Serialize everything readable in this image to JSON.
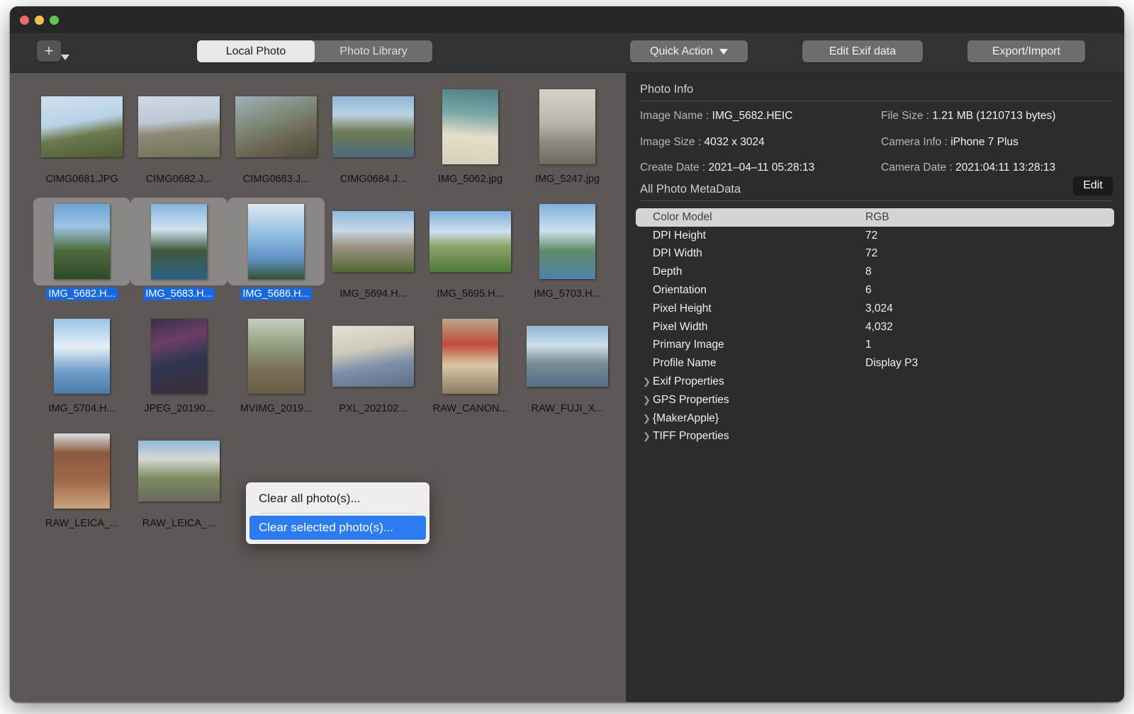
{
  "window": {
    "traffic_lights": [
      "close",
      "minimize",
      "maximize"
    ]
  },
  "toolbar": {
    "add_button": "+",
    "add_caret_icon": "caret-down-icon",
    "segments": [
      {
        "label": "Local Photo",
        "active": true
      },
      {
        "label": "Photo Library",
        "active": false
      }
    ],
    "quick_action": "Quick Action",
    "quick_action_caret": "caret-down-icon",
    "edit_exif": "Edit Exif data",
    "export_import": "Export/Import"
  },
  "grid": {
    "photos": [
      {
        "name": "CIMG0681.JPG",
        "selected": false,
        "orient": "landscape",
        "scene": "temple"
      },
      {
        "name": "CIMG0682.J...",
        "selected": false,
        "orient": "landscape",
        "scene": "pavilion"
      },
      {
        "name": "CIMG0683.J...",
        "selected": false,
        "orient": "landscape",
        "scene": "building"
      },
      {
        "name": "CIMG0684.J...",
        "selected": false,
        "orient": "landscape",
        "scene": "canal"
      },
      {
        "name": "IMG_5062.jpg",
        "selected": false,
        "orient": "portrait",
        "scene": "beach"
      },
      {
        "name": "IMG_5247.jpg",
        "selected": false,
        "orient": "portrait",
        "scene": "station"
      },
      {
        "name": "IMG_5682.H...",
        "selected": true,
        "orient": "portrait",
        "scene": "palm-sky"
      },
      {
        "name": "IMG_5683.H...",
        "selected": true,
        "orient": "portrait",
        "scene": "pool-sky"
      },
      {
        "name": "IMG_5686.H...",
        "selected": true,
        "orient": "portrait",
        "scene": "clouds"
      },
      {
        "name": "IMG_5694.H...",
        "selected": false,
        "orient": "landscape",
        "scene": "resort"
      },
      {
        "name": "IMG_5695.H...",
        "selected": false,
        "orient": "landscape",
        "scene": "lawn"
      },
      {
        "name": "IMG_5703.H...",
        "selected": false,
        "orient": "portrait",
        "scene": "sea"
      },
      {
        "name": "IMG_5704.H...",
        "selected": false,
        "orient": "portrait",
        "scene": "clouds2"
      },
      {
        "name": "JPEG_20190...",
        "selected": false,
        "orient": "portrait",
        "scene": "city-night"
      },
      {
        "name": "MVIMG_2019...",
        "selected": false,
        "orient": "portrait",
        "scene": "deer-forest"
      },
      {
        "name": "PXL_202102...",
        "selected": false,
        "orient": "landscape",
        "scene": "cafe"
      },
      {
        "name": "RAW_CANON...",
        "selected": false,
        "orient": "portrait",
        "scene": "red-box"
      },
      {
        "name": "RAW_FUJI_X...",
        "selected": false,
        "orient": "landscape",
        "scene": "harbor"
      },
      {
        "name": "RAW_LEICA_...",
        "selected": false,
        "orient": "portrait",
        "scene": "bookshelf"
      },
      {
        "name": "RAW_LEICA_...",
        "selected": false,
        "orient": "landscape",
        "scene": "street"
      }
    ]
  },
  "context_menu": {
    "items": [
      {
        "label": "Clear all photo(s)...",
        "highlight": false
      },
      {
        "label": "Clear selected photo(s)...",
        "highlight": true
      }
    ]
  },
  "photo_info": {
    "title": "Photo Info",
    "image_name_label": "Image Name :",
    "image_name_value": "IMG_5682.HEIC",
    "file_size_label": "File Size :",
    "file_size_value": "1.21 MB (1210713 bytes)",
    "image_size_label": "Image Size :",
    "image_size_value": "4032 x 3024",
    "camera_info_label": "Camera Info :",
    "camera_info_value": "iPhone 7 Plus",
    "create_date_label": "Create Date :",
    "create_date_value": "2021–04–11 05:28:13",
    "camera_date_label": "Camera Date :",
    "camera_date_value": "2021:04:11 13:28:13"
  },
  "metadata": {
    "title": "All Photo MetaData",
    "edit_label": "Edit",
    "rows": [
      {
        "key": "Color Model",
        "value": "RGB",
        "selected": true,
        "expandable": false
      },
      {
        "key": "DPI Height",
        "value": "72",
        "selected": false,
        "expandable": false
      },
      {
        "key": "DPI Width",
        "value": "72",
        "selected": false,
        "expandable": false
      },
      {
        "key": "Depth",
        "value": "8",
        "selected": false,
        "expandable": false
      },
      {
        "key": "Orientation",
        "value": "6",
        "selected": false,
        "expandable": false
      },
      {
        "key": "Pixel Height",
        "value": "3,024",
        "selected": false,
        "expandable": false
      },
      {
        "key": "Pixel Width",
        "value": "4,032",
        "selected": false,
        "expandable": false
      },
      {
        "key": "Primary Image",
        "value": "1",
        "selected": false,
        "expandable": false
      },
      {
        "key": "Profile Name",
        "value": "Display P3",
        "selected": false,
        "expandable": false
      },
      {
        "key": "Exif Properties",
        "value": "",
        "selected": false,
        "expandable": true
      },
      {
        "key": "GPS Properties",
        "value": "",
        "selected": false,
        "expandable": true
      },
      {
        "key": "{MakerApple}",
        "value": "",
        "selected": false,
        "expandable": true
      },
      {
        "key": "TIFF Properties",
        "value": "",
        "selected": false,
        "expandable": true
      }
    ]
  },
  "colors": {
    "grid_bg": "#5d5855",
    "panel_bg": "#2c2c2c",
    "selection_blue": "#1869e0",
    "menu_highlight": "#2a7cf0",
    "toolbar_bg": "#333232"
  }
}
